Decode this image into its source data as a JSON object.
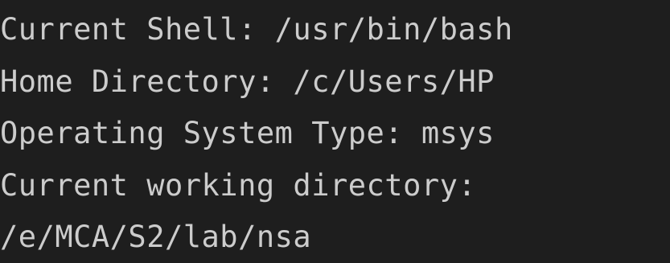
{
  "terminal": {
    "lines": [
      "Current Shell: /usr/bin/bash",
      "Home Directory: /c/Users/HP",
      "Operating System Type: msys",
      "Current working directory:",
      "/e/MCA/S2/lab/nsa"
    ]
  },
  "colors": {
    "background": "#1e1e1e",
    "text": "#cccccc"
  }
}
